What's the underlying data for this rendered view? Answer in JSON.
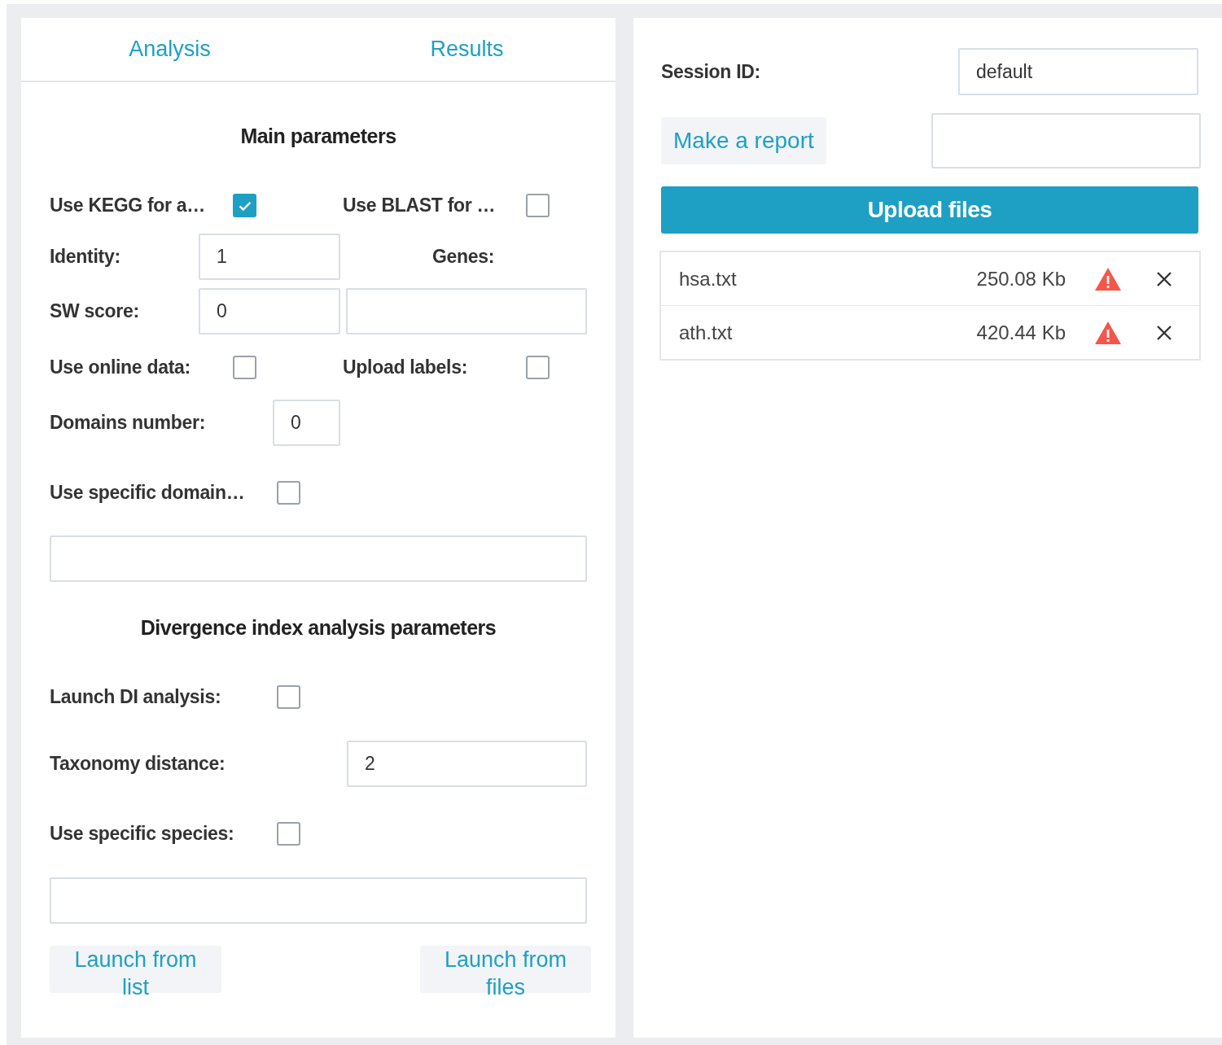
{
  "tabs": [
    {
      "label": "Analysis"
    },
    {
      "label": "Results"
    }
  ],
  "main": {
    "title": "Main parameters",
    "use_kegg": {
      "label": "Use KEGG for a…",
      "checked": true
    },
    "use_blast": {
      "label": "Use BLAST for …",
      "checked": false
    },
    "identity": {
      "label": "Identity:",
      "value": "1"
    },
    "genes": {
      "label": "Genes:"
    },
    "sw_score": {
      "label": "SW score:",
      "value": "0"
    },
    "use_online_data": {
      "label": "Use online data:",
      "checked": false
    },
    "upload_labels": {
      "label": "Upload labels:",
      "checked": false
    },
    "domains_number": {
      "label": "Domains number:",
      "value": "0"
    },
    "use_specific_domains": {
      "label": "Use specific domain…",
      "checked": false
    }
  },
  "divergence": {
    "title": "Divergence index analysis parameters",
    "launch_di": {
      "label": "Launch DI analysis:",
      "checked": false
    },
    "taxonomy_distance": {
      "label": "Taxonomy distance:",
      "value": "2"
    },
    "use_specific_species": {
      "label": "Use specific species:",
      "checked": false
    }
  },
  "launch_buttons": [
    "Launch from list",
    "Launch from files"
  ],
  "session": {
    "label": "Session ID:",
    "value": "default"
  },
  "report_button": "Make a report",
  "upload_button": "Upload files",
  "files": [
    {
      "name": "hsa.txt",
      "size": "250.08 Kb"
    },
    {
      "name": "ath.txt",
      "size": "420.44 Kb"
    }
  ]
}
